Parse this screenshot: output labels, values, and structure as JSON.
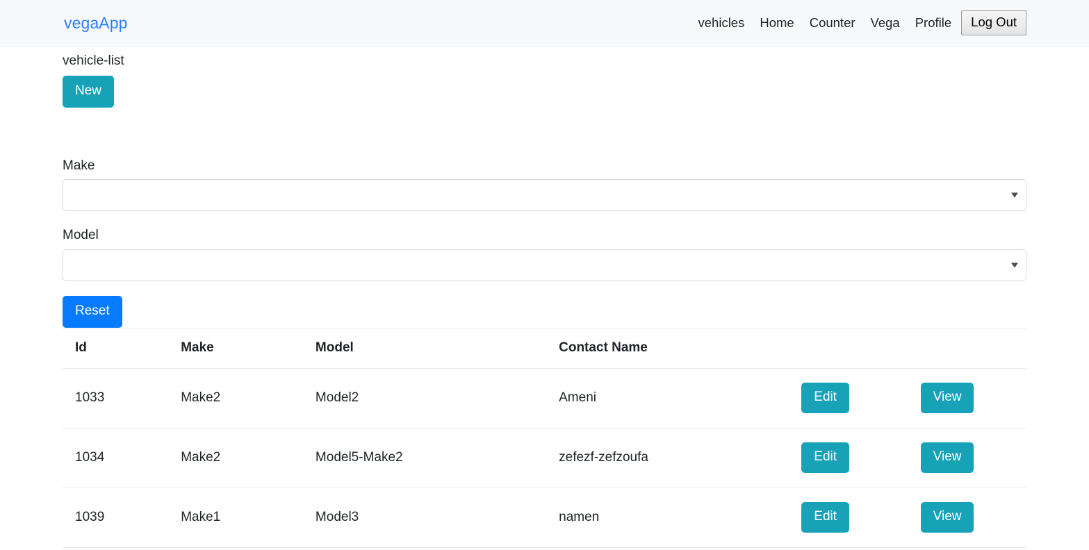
{
  "navbar": {
    "brand": "vegaApp",
    "links": [
      {
        "label": "vehicles"
      },
      {
        "label": "Home"
      },
      {
        "label": "Counter"
      },
      {
        "label": "Vega"
      },
      {
        "label": "Profile"
      }
    ],
    "logout_label": "Log Out",
    "brand_color": "#2a7fff",
    "background_color": "#f8f9fa"
  },
  "page": {
    "label": "vehicle-list",
    "new_button_label": "New"
  },
  "filters": {
    "make": {
      "label": "Make",
      "value": "",
      "arrow_icon": "chevron-down-icon"
    },
    "model": {
      "label": "Model",
      "value": "",
      "arrow_icon": "chevron-down-icon"
    },
    "reset_label": "Reset"
  },
  "table": {
    "headers": [
      "Id",
      "Make",
      "Model",
      "Contact Name",
      "",
      ""
    ],
    "row_action_edit": "Edit",
    "row_action_view": "View",
    "rows": [
      {
        "id": "1033",
        "make": "Make2",
        "model": "Model2",
        "contact": "Ameni",
        "edit": "Edit",
        "view": "View"
      },
      {
        "id": "1034",
        "make": "Make2",
        "model": "Model5-Make2",
        "contact": "zefezf-zefzoufa",
        "edit": "Edit",
        "view": "View"
      },
      {
        "id": "1039",
        "make": "Make1",
        "model": "Model3",
        "contact": "namen",
        "edit": "Edit",
        "view": "View"
      }
    ]
  },
  "colors": {
    "teal": "#17a2b8",
    "blue": "#077bff",
    "brand_blue": "#2a7fff",
    "border": "#e6e8ea"
  }
}
